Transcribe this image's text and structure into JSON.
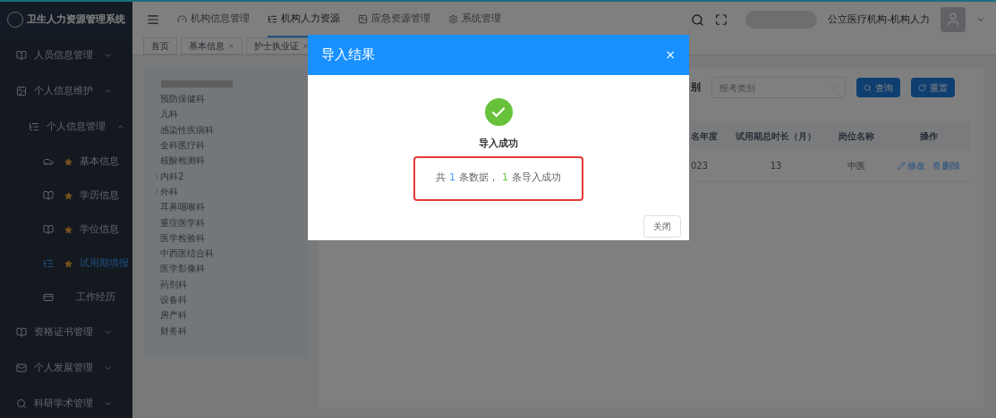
{
  "brand": {
    "title": "卫生人力资源管理系统"
  },
  "top_nav": [
    {
      "label": "机构信息管理",
      "selected": false
    },
    {
      "label": "机构人力资源",
      "selected": true
    },
    {
      "label": "应急资源管理",
      "selected": false
    },
    {
      "label": "系统管理",
      "selected": false
    }
  ],
  "user": {
    "org": "公立医疗机构-机构人力"
  },
  "sidebar": {
    "items": [
      {
        "label": "人员信息管理",
        "expanded": false,
        "selected": false
      },
      {
        "label": "个人信息维护",
        "expanded": true,
        "selected": false,
        "children": [
          {
            "label": "个人信息管理",
            "expanded": true,
            "selected": false,
            "children": [
              {
                "label": "基本信息",
                "starred": true,
                "selected": false
              },
              {
                "label": "学历信息",
                "starred": true,
                "selected": false
              },
              {
                "label": "学位信息",
                "starred": true,
                "selected": false
              },
              {
                "label": "试用期填报",
                "starred": true,
                "selected": true
              },
              {
                "label": "工作经历",
                "starred": false,
                "selected": false
              }
            ]
          }
        ]
      },
      {
        "label": "资格证书管理",
        "expanded": false,
        "selected": false
      },
      {
        "label": "个人发展管理",
        "expanded": false,
        "selected": false
      },
      {
        "label": "科研学术管理",
        "expanded": false,
        "selected": false
      }
    ]
  },
  "page_tabs": [
    {
      "label": "首页",
      "closable": false
    },
    {
      "label": "基本信息",
      "closable": true
    },
    {
      "label": "护士执业证",
      "closable": true
    }
  ],
  "dept_tree": [
    {
      "label": "预防保健科",
      "has_children": false
    },
    {
      "label": "儿科",
      "has_children": false
    },
    {
      "label": "感染性疾病科",
      "has_children": false
    },
    {
      "label": "全科医疗科",
      "has_children": false
    },
    {
      "label": "核酸检测科",
      "has_children": false
    },
    {
      "label": "内科2",
      "has_children": true
    },
    {
      "label": "外科",
      "has_children": true
    },
    {
      "label": "耳鼻咽喉科",
      "has_children": false
    },
    {
      "label": "重症医学科",
      "has_children": false
    },
    {
      "label": "医学检验科",
      "has_children": false
    },
    {
      "label": "中西医结合科",
      "has_children": false
    },
    {
      "label": "医学影像科",
      "has_children": false
    },
    {
      "label": "药剂科",
      "has_children": false
    },
    {
      "label": "设备科",
      "has_children": false
    },
    {
      "label": "房产科",
      "has_children": false
    },
    {
      "label": "财务科",
      "has_children": false
    }
  ],
  "filter": {
    "label": "别",
    "placeholder": "报考类别",
    "buttons": [
      {
        "kind": "search",
        "label": "查询"
      },
      {
        "kind": "reset",
        "label": "重置"
      }
    ]
  },
  "table": {
    "columns": [
      "名年度",
      "试用期总时长（月）",
      "岗位名称",
      "操作"
    ],
    "rows": [
      {
        "cells": [
          "023",
          "13",
          "中医"
        ],
        "actions": [
          {
            "kind": "edit",
            "label": "修改"
          },
          {
            "kind": "delete",
            "label": "删除"
          }
        ]
      }
    ]
  },
  "dialog": {
    "title": "导入结果",
    "close": "×",
    "status": "导入成功",
    "highlighted": true,
    "message": [
      {
        "text": "共"
      },
      {
        "text": "1",
        "color": "#409eff"
      },
      {
        "text": "条数据，"
      },
      {
        "text": "1",
        "color": "#67c23a"
      },
      {
        "text": "条导入成功"
      }
    ],
    "button": "关闭"
  }
}
